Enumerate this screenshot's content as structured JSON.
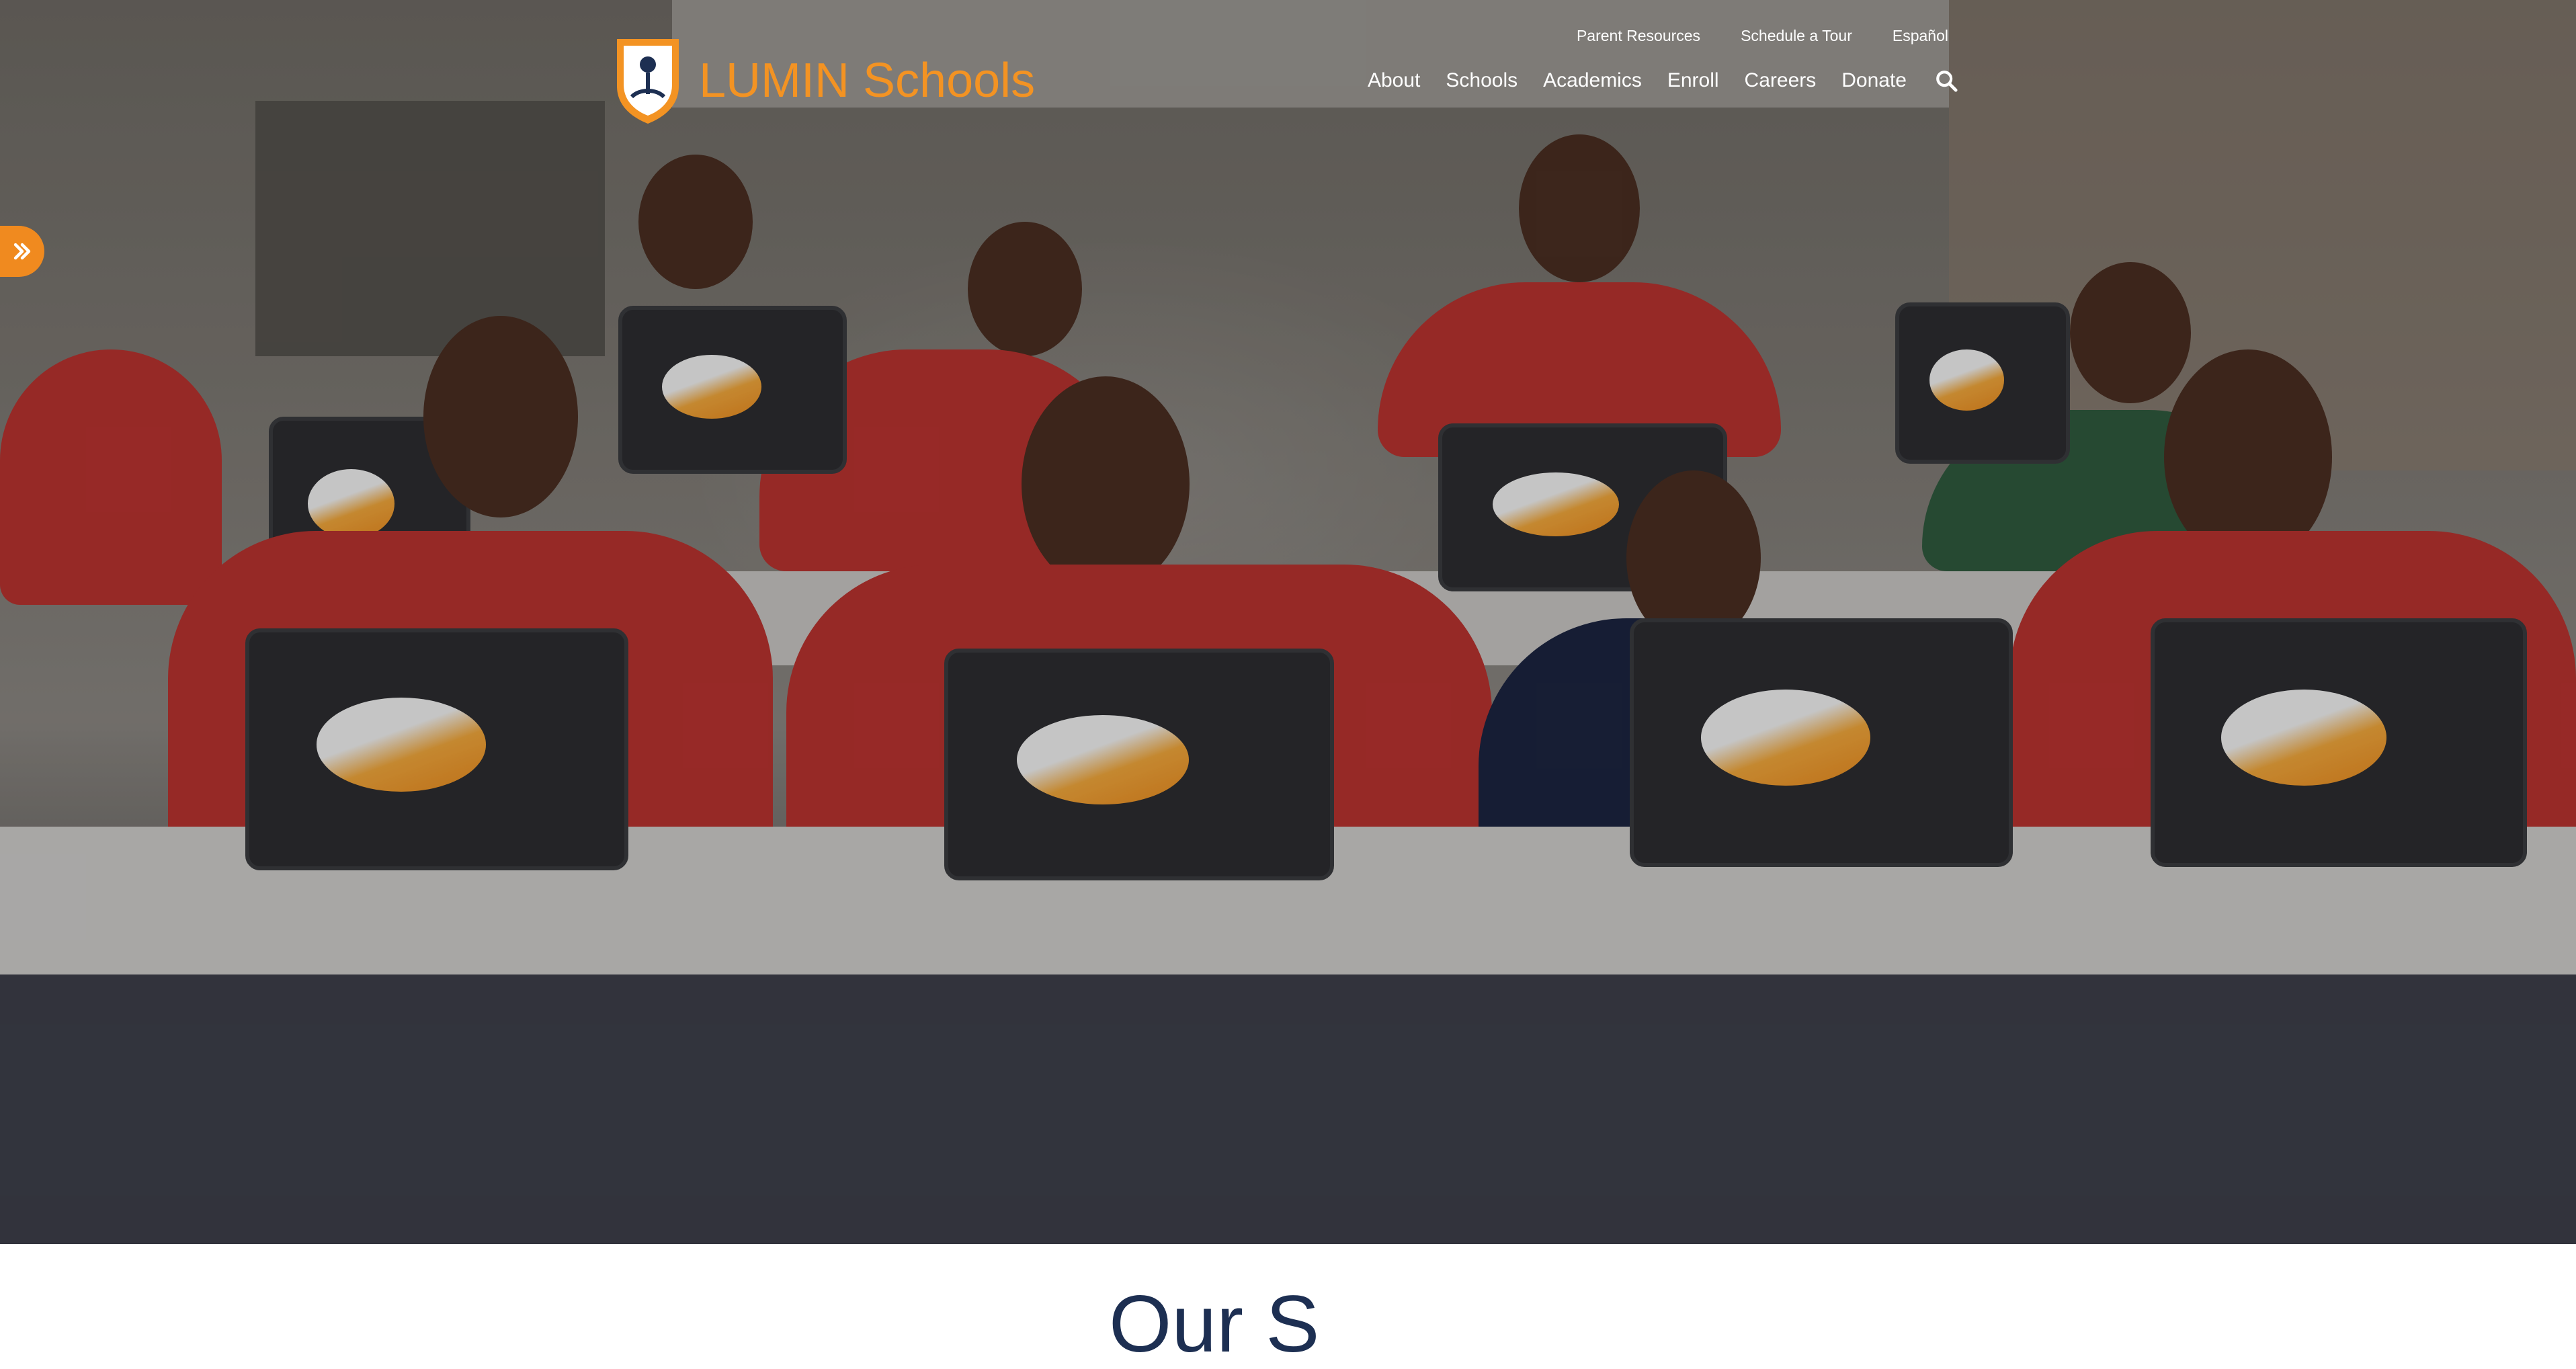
{
  "brand": {
    "name": "LUMIN Schools",
    "accent_color": "#f39323",
    "navy_color": "#1d2f52"
  },
  "utility_nav": {
    "items": [
      "Parent Resources",
      "Schedule a Tour",
      "Español"
    ]
  },
  "main_nav": {
    "items": [
      "About",
      "Schools",
      "Academics",
      "Enroll",
      "Careers",
      "Donate"
    ],
    "search_icon": "search-icon"
  },
  "side_tab": {
    "icon": "double-chevron-right-icon",
    "color": "#f08a1f"
  },
  "hero": {
    "image_subject": "students at laptops in classroom"
  },
  "section": {
    "title": "Our S"
  }
}
